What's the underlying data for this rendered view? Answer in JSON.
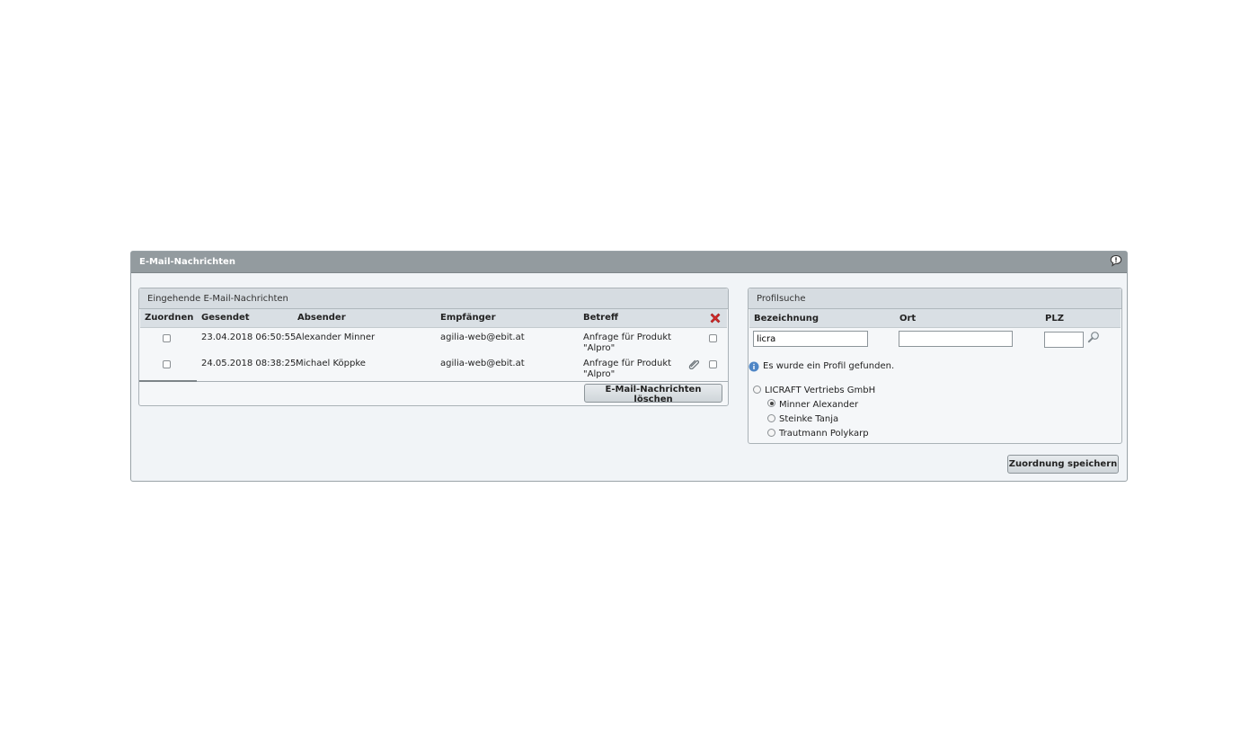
{
  "window": {
    "title": "E-Mail-Nachrichten",
    "help_icon": "speech-bubble-help-icon"
  },
  "messages": {
    "title": "Eingehende E-Mail-Nachrichten",
    "columns": {
      "assign": "Zuordnen",
      "sent": "Gesendet",
      "sender": "Absender",
      "recipient": "Empfänger",
      "subject": "Betreff"
    },
    "delete_icon": "red-x-icon",
    "rows": [
      {
        "sent": "23.04.2018 06:50:55",
        "sender": "Alexander Minner",
        "recipient": "agilia-web@ebit.at",
        "subject_line1": "Anfrage für Produkt",
        "subject_line2": "\"Alpro\"",
        "attachment": false
      },
      {
        "sent": "24.05.2018 08:38:25",
        "sender": "Michael Köppke",
        "recipient": "agilia-web@ebit.at",
        "subject_line1": "Anfrage für Produkt",
        "subject_line2": "\"Alpro\"",
        "attachment": true
      }
    ],
    "delete_button": "E-Mail-Nachrichten löschen"
  },
  "profile": {
    "title": "Profilsuche",
    "labels": {
      "name": "Bezeichnung",
      "city": "Ort",
      "zip": "PLZ"
    },
    "values": {
      "name": "licra",
      "city": "",
      "zip": ""
    },
    "info": "Es wurde ein Profil gefunden.",
    "company": "LICRAFT Vertriebs GmbH",
    "contacts": [
      {
        "name": "Minner Alexander",
        "selected": true
      },
      {
        "name": "Steinke Tanja",
        "selected": false
      },
      {
        "name": "Trautmann Polykarp",
        "selected": false
      }
    ],
    "save_button": "Zuordnung speichern"
  }
}
